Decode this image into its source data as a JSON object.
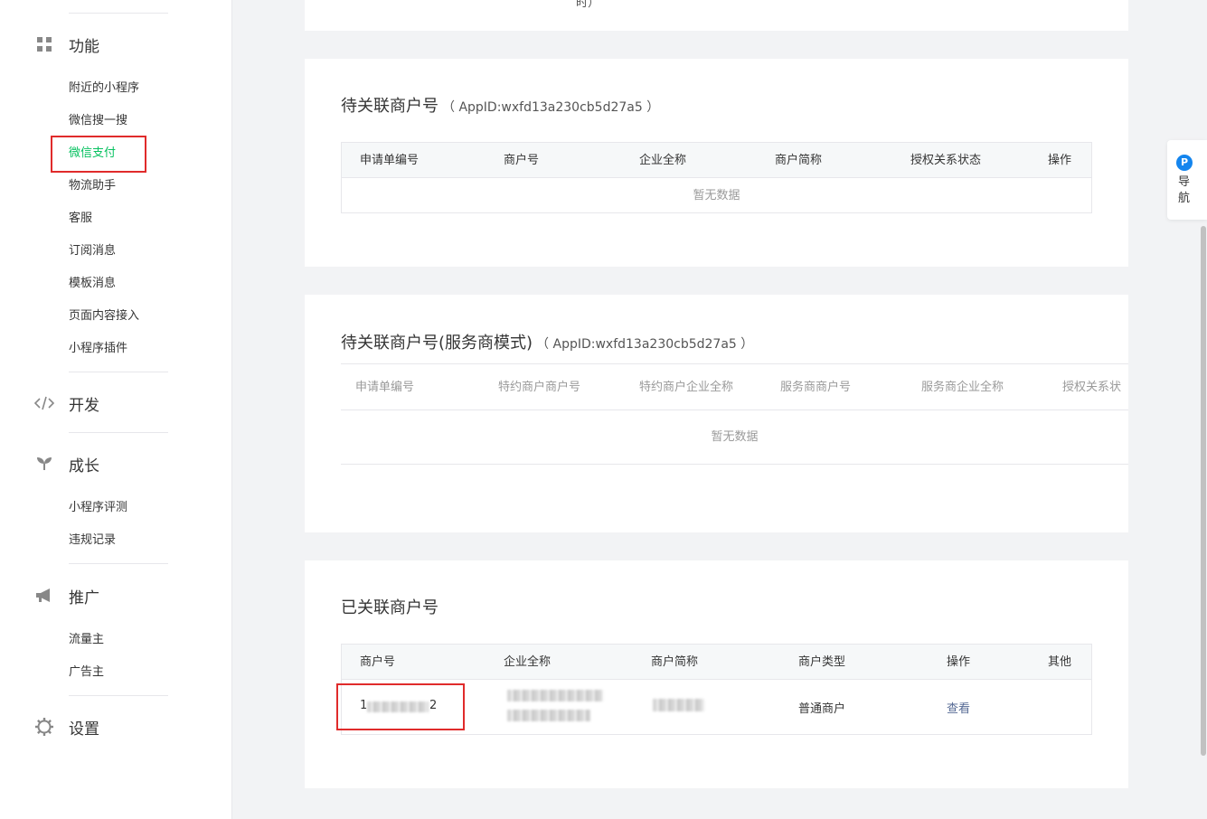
{
  "sidebar": {
    "sections": {
      "features": {
        "label": "功能",
        "icon": "grid-icon"
      },
      "develop": {
        "label": "开发",
        "icon": "code-icon"
      },
      "growth": {
        "label": "成长",
        "icon": "sprout-icon"
      },
      "promotion": {
        "label": "推广",
        "icon": "megaphone-icon"
      },
      "settings": {
        "label": "设置",
        "icon": "gear-icon"
      }
    },
    "feature_items": [
      "附近的小程序",
      "微信搜一搜",
      "微信支付",
      "物流助手",
      "客服",
      "订阅消息",
      "模板消息",
      "页面内容接入",
      "小程序插件"
    ],
    "growth_items": [
      "小程序评测",
      "违规记录"
    ],
    "promotion_items": [
      "流量主",
      "广告主"
    ],
    "active_item": "微信支付"
  },
  "top_card": {
    "partial_text": "时）"
  },
  "pending": {
    "title": "待关联商户号",
    "appid": "（ AppID:wxfd13a230cb5d27a5 ）",
    "columns": [
      "申请单编号",
      "商户号",
      "企业全称",
      "商户简称",
      "授权关系状态",
      "操作"
    ],
    "empty": "暂无数据"
  },
  "pending_provider": {
    "title": "待关联商户号(服务商模式)",
    "appid": "（ AppID:wxfd13a230cb5d27a5 ）",
    "columns": [
      "申请单编号",
      "特约商户商户号",
      "特约商户企业全称",
      "服务商商户号",
      "服务商企业全称",
      "授权关系状"
    ],
    "empty": "暂无数据"
  },
  "linked": {
    "title": "已关联商户号",
    "columns": [
      "商户号",
      "企业全称",
      "商户简称",
      "商户类型",
      "操作",
      "其他"
    ],
    "row": {
      "merchant_id_start": "1",
      "merchant_id_end": "2",
      "type": "普通商户",
      "action": "查看"
    }
  },
  "float_nav": {
    "badge": "P",
    "label": "导航"
  },
  "colors": {
    "active": "#07c160",
    "highlight_border": "#e02b2b",
    "link": "#576b95",
    "badge": "#1485ee"
  }
}
